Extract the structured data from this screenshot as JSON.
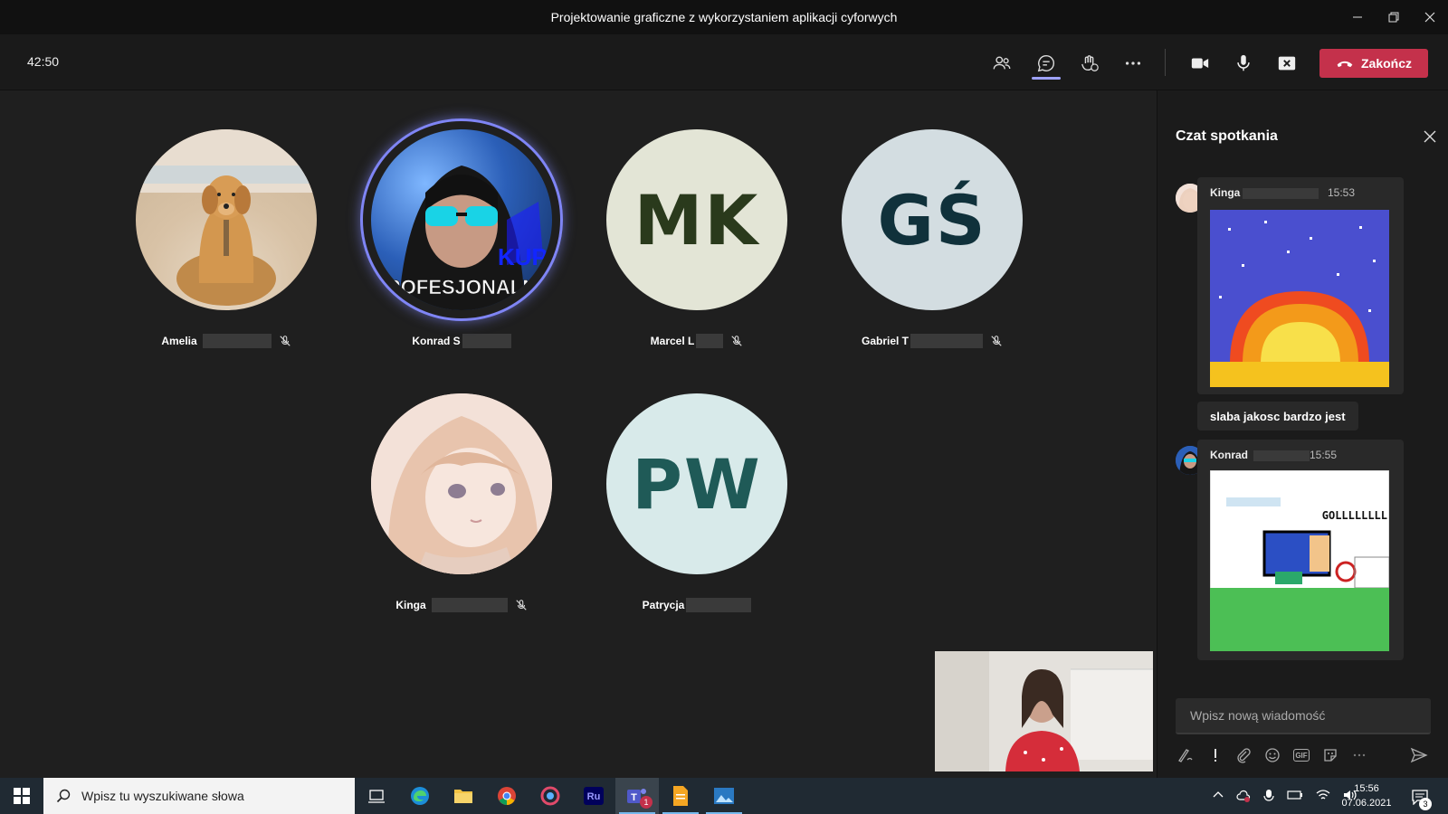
{
  "window": {
    "title": "Projektowanie graficzne z wykorzystaniem aplikacji cyforwych"
  },
  "toolbar": {
    "timer": "42:50",
    "end_label": "Zakończ",
    "icons": [
      "participants-icon",
      "chat-icon",
      "reactions-icon",
      "more-icon",
      "camera-icon",
      "mic-icon",
      "share-stop-icon",
      "hangup-icon"
    ]
  },
  "participants": [
    {
      "name": "Amelia",
      "initials": "",
      "muted": true
    },
    {
      "name": "Konrad S",
      "initials": "",
      "muted": false,
      "speaking": true,
      "avatar_text": "PROFESJONALNY"
    },
    {
      "name": "Marcel L",
      "initials": "MK",
      "muted": true
    },
    {
      "name": "Gabriel T",
      "initials": "GŚ",
      "muted": true
    },
    {
      "name": "Kinga",
      "initials": "",
      "muted": true
    },
    {
      "name": "Patrycja",
      "initials": "PW",
      "muted": false
    }
  ],
  "chat": {
    "title": "Czat spotkania",
    "messages": [
      {
        "author": "Kinga",
        "time": "15:53",
        "text": "slaba jakosc bardzo jest"
      },
      {
        "author": "Konrad",
        "time": "15:55",
        "image_text": "GOLLLLLLLL"
      }
    ],
    "compose_placeholder": "Wpisz nową wiadomość"
  },
  "taskbar": {
    "search_placeholder": "Wpisz tu wyszukiwane słowa",
    "time": "15:56",
    "date": "07.06.2021",
    "notifications": "3",
    "apps": [
      "task-view",
      "edge",
      "file-explorer",
      "chrome",
      "app-4",
      "rush",
      "teams",
      "notes",
      "photos"
    ],
    "teams_badge": "1"
  },
  "colors": {
    "accent": "#7f85f5",
    "end_button": "#c4314b",
    "stage_bg": "#1f1f1f"
  }
}
